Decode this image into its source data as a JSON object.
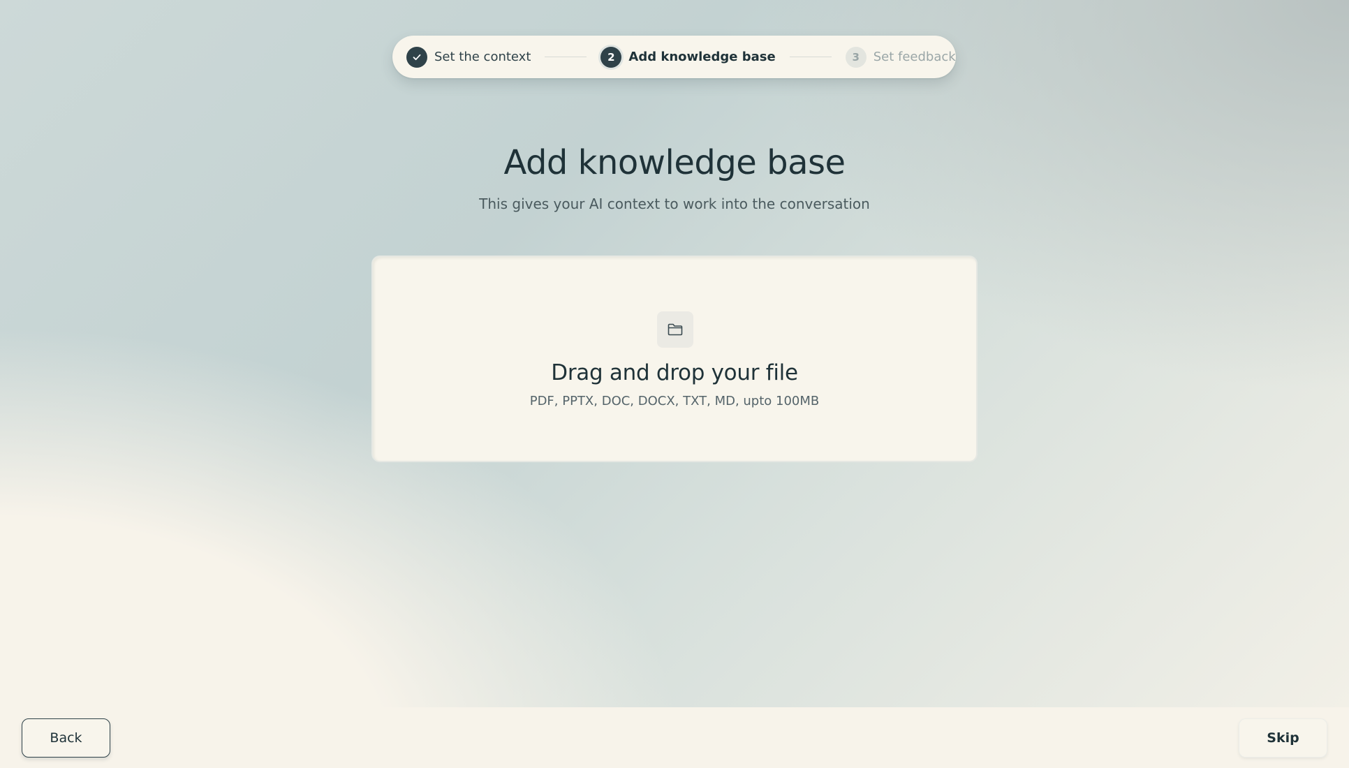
{
  "stepper": {
    "steps": [
      {
        "number": "",
        "label": "Set the context",
        "state": "done",
        "icon": "check-icon"
      },
      {
        "number": "2",
        "label": "Add knowledge base",
        "state": "active"
      },
      {
        "number": "3",
        "label": "Set feedback",
        "state": "todo"
      }
    ]
  },
  "main": {
    "title": "Add knowledge base",
    "subtitle": "This gives your AI context to work into the conversation"
  },
  "dropzone": {
    "icon": "folder-icon",
    "title": "Drag and drop your file",
    "formats": "PDF, PPTX, DOC, DOCX, TXT, MD, upto 100MB"
  },
  "footer": {
    "back_label": "Back",
    "skip_label": "Skip"
  },
  "colors": {
    "accent": "#2f4249",
    "background_cream": "#f7f3ea",
    "muted_text": "#9aa6a7"
  }
}
